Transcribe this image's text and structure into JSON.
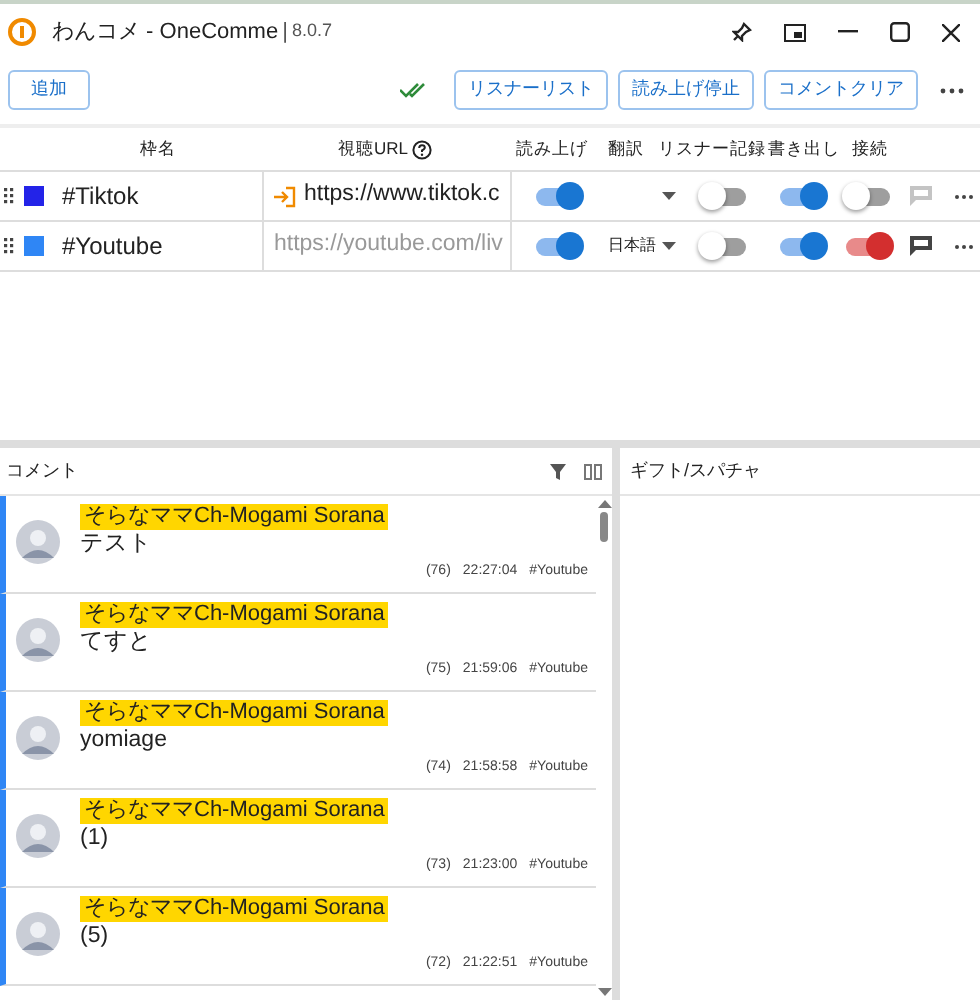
{
  "window": {
    "title": "わんコメ - OneComme",
    "separator": "|",
    "version": "8.0.7"
  },
  "toolbar": {
    "add_button": "追加",
    "buttons": [
      "リスナーリスト",
      "読み上げ停止",
      "コメントクリア"
    ]
  },
  "table": {
    "columns": [
      "枠名",
      "視聴URL",
      "読み上げ",
      "翻訳",
      "リスナー記録",
      "書き出し",
      "接続"
    ],
    "rows": [
      {
        "name": "#Tiktok",
        "color": "#2323e8",
        "url": "https://www.tiktok.c",
        "url_is_placeholder": false,
        "login_icon": true,
        "read_aloud": true,
        "translation": "",
        "listener_record": false,
        "export": true,
        "connected": false,
        "comment_enabled": false
      },
      {
        "name": "#Youtube",
        "color": "#2f86f5",
        "url": "https://youtube.com/liv",
        "url_is_placeholder": true,
        "login_icon": false,
        "read_aloud": true,
        "translation": "日本語",
        "listener_record": false,
        "export": true,
        "connected": true,
        "comment_enabled": true
      }
    ]
  },
  "comments_panel": {
    "title": "コメント",
    "comments": [
      {
        "name": "そらなママCh-Mogami Sorana",
        "text": "テスト",
        "count": "(76)",
        "time": "22:27:04",
        "frame": "#Youtube"
      },
      {
        "name": "そらなママCh-Mogami Sorana",
        "text": "てすと",
        "count": "(75)",
        "time": "21:59:06",
        "frame": "#Youtube"
      },
      {
        "name": "そらなママCh-Mogami Sorana",
        "text": "yomiage",
        "count": "(74)",
        "time": "21:58:58",
        "frame": "#Youtube"
      },
      {
        "name": "そらなママCh-Mogami Sorana",
        "text": "(1)",
        "count": "(73)",
        "time": "21:23:00",
        "frame": "#Youtube"
      },
      {
        "name": "そらなママCh-Mogami Sorana",
        "text": "(5)",
        "count": "(72)",
        "time": "21:22:51",
        "frame": "#Youtube"
      }
    ]
  },
  "gifts_panel": {
    "title": "ギフト/スパチャ"
  }
}
